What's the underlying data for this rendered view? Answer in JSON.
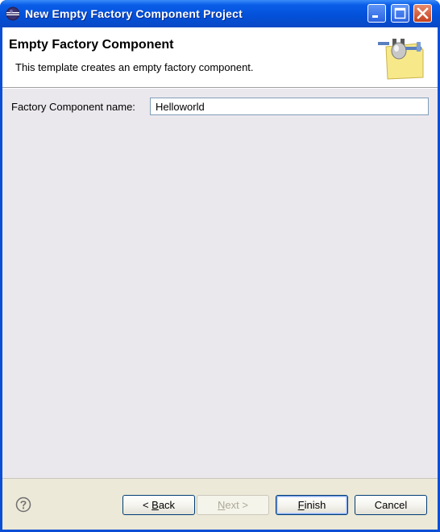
{
  "window": {
    "title": "New Empty Factory Component Project",
    "icon": "eclipse-icon",
    "controls": [
      "minimize-icon",
      "maximize-icon",
      "close-icon"
    ]
  },
  "banner": {
    "title": "Empty Factory Component",
    "description": "This template creates an empty factory component.",
    "image": "factory-component-wizard-icon"
  },
  "form": {
    "name_label": "Factory Component name:",
    "name_value": "Helloworld"
  },
  "buttons": {
    "back": {
      "mnemonic": "B",
      "rest": "ack",
      "prefix": "< "
    },
    "next": {
      "mnemonic": "N",
      "rest": "ext",
      "suffix": " >",
      "enabled": false
    },
    "finish": {
      "mnemonic": "F",
      "rest": "inish"
    },
    "cancel": {
      "label": "Cancel"
    }
  },
  "help": {
    "icon": "help-icon"
  }
}
